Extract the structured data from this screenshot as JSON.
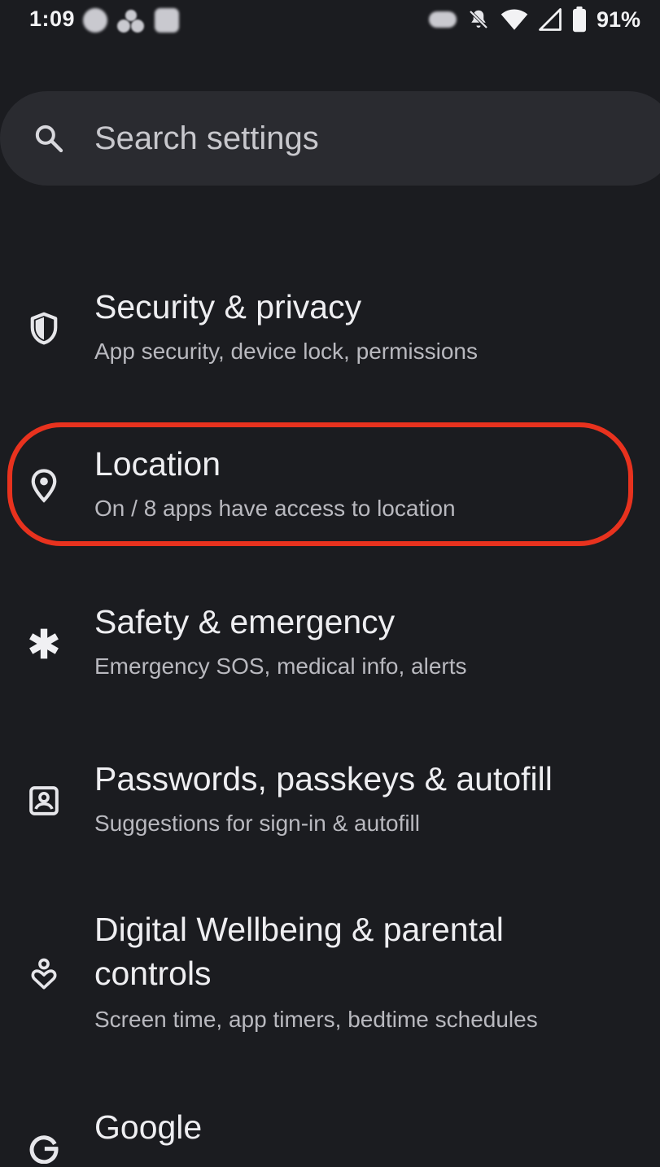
{
  "status_bar": {
    "time": "1:09",
    "battery": "91%",
    "icons": [
      "notification-dot-icon",
      "notification-cluster-icon",
      "notification-square-icon",
      "cast-icon",
      "mute-icon",
      "wifi-icon",
      "cell-signal-icon",
      "battery-icon"
    ]
  },
  "search": {
    "placeholder": "Search settings",
    "icon": "search-icon"
  },
  "settings": {
    "items": [
      {
        "title": "Security & privacy",
        "subtitle": "App security, device lock, permissions",
        "icon": "shield-icon"
      },
      {
        "title": "Location",
        "subtitle": "On / 8 apps have access to location",
        "icon": "location-pin-icon",
        "highlighted": true
      },
      {
        "title": "Safety & emergency",
        "subtitle": "Emergency SOS, medical info, alerts",
        "icon": "asterisk-icon"
      },
      {
        "title": "Passwords, passkeys & autofill",
        "subtitle": "Suggestions for sign-in & autofill",
        "icon": "account-box-icon"
      },
      {
        "title_line1": "Digital Wellbeing & parental",
        "title_line2": "controls",
        "subtitle": "Screen time, app timers, bedtime schedules",
        "icon": "wellbeing-icon"
      },
      {
        "title": "Google",
        "icon": "google-icon"
      }
    ]
  },
  "colors": {
    "background": "#1b1c20",
    "search_bg": "#2a2b30",
    "highlight": "#e8321e"
  }
}
